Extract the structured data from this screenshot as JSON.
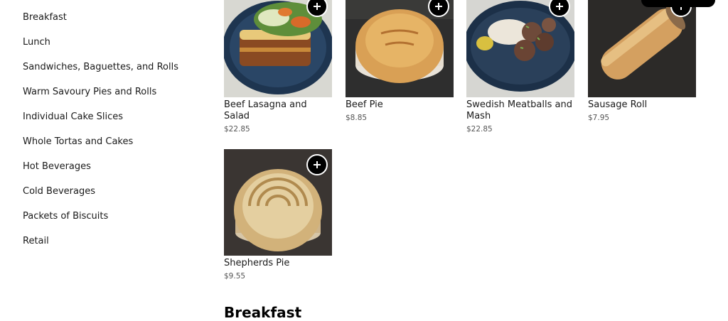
{
  "sidebar": {
    "items": [
      {
        "label": "Breakfast"
      },
      {
        "label": "Lunch"
      },
      {
        "label": "Sandwiches, Baguettes, and Rolls"
      },
      {
        "label": "Warm Savoury Pies and Rolls"
      },
      {
        "label": "Individual Cake Slices"
      },
      {
        "label": "Whole Tortas and Cakes"
      },
      {
        "label": "Hot Beverages"
      },
      {
        "label": "Cold Beverages"
      },
      {
        "label": "Packets of Biscuits"
      },
      {
        "label": "Retail"
      }
    ]
  },
  "products": [
    {
      "name": "Beef Lasagna and Salad",
      "price": "$22.85"
    },
    {
      "name": "Beef Pie",
      "price": "$8.85"
    },
    {
      "name": "Swedish Meatballs and Mash",
      "price": "$22.85"
    },
    {
      "name": "Sausage Roll",
      "price": "$7.95"
    },
    {
      "name": "Shepherds Pie",
      "price": "$9.55"
    }
  ],
  "section": {
    "heading": "Breakfast"
  },
  "icons": {
    "add": "plus-icon"
  },
  "colors": {
    "accent": "#000000",
    "price_text": "#545454"
  }
}
